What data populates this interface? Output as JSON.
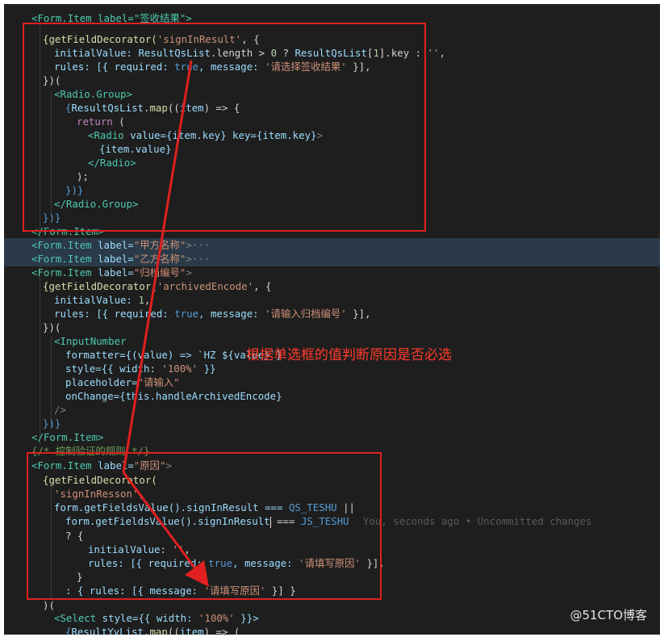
{
  "code": {
    "l1": [
      "<Form.Item label=\"签收结果\">"
    ],
    "l2": [
      "{getFieldDecorator(",
      "'signInResult'",
      ", {"
    ],
    "l3": [
      "initialValue: ",
      "ResultQsList",
      ".length > ",
      "0",
      " ? ",
      "ResultQsList",
      "[",
      "1",
      "].key : ",
      "''",
      ","
    ],
    "l4": [
      "rules: [{ required: ",
      "true",
      ", message: ",
      "'请选择签收结果'",
      " }],"
    ],
    "l5": [
      "})("
    ],
    "l6": [
      "<Radio.Group>"
    ],
    "l7": [
      "{",
      "ResultQsList",
      ".",
      "map",
      "((",
      "item",
      ") => {"
    ],
    "l8": [
      "return",
      " ("
    ],
    "l9": [
      "<Radio",
      " value=",
      "{item.key}",
      " key=",
      "{item.key}",
      ">"
    ],
    "l10": [
      "{item.value}"
    ],
    "l11": [
      "</Radio>"
    ],
    "l12": [
      ");"
    ],
    "l13": [
      "})}"
    ],
    "l14": [
      "</Radio.Group>"
    ],
    "l15": [
      "})}"
    ],
    "l16": [
      "</Form.Item>"
    ],
    "l17": [
      "<Form.Item",
      " label=",
      "\"甲方名称\"",
      ">···"
    ],
    "l18": [
      "<Form.Item",
      " label=",
      "\"乙方名称\"",
      ">···"
    ],
    "l19": [
      "<Form.Item",
      " label=",
      "\"归档编号\"",
      ">"
    ],
    "l20": [
      "{getFieldDecorator(",
      "'archivedEncode'",
      ", {"
    ],
    "l21": [
      "initialValue: ",
      "1",
      ","
    ],
    "l22": [
      "rules: [{ required: ",
      "true",
      ", message: ",
      "'请输入归档编号'",
      " }],"
    ],
    "l23": [
      "})("
    ],
    "l24": [
      "<InputNumber"
    ],
    "l25": [
      "formatter=",
      "{(value) => `HZ ${value}`}"
    ],
    "l26": [
      "style=",
      "{{ width: ",
      "'100%'",
      " }}"
    ],
    "l27": [
      "placeholder=",
      "\"请输入\""
    ],
    "l28": [
      "onChange=",
      "{this.handleArchivedEncode}"
    ],
    "l29": [
      "/>"
    ],
    "l30": [
      "})}"
    ],
    "l31": [
      "</Form.Item>"
    ],
    "l32": [
      "{/* 控制验证的规则 */}"
    ],
    "l33": [
      "<Form.Item",
      " label=",
      "\"原因\"",
      ">"
    ],
    "l34": [
      "{getFieldDecorator("
    ],
    "l35": [
      "'signInResson'",
      ","
    ],
    "l36": [
      "form.getFieldsValue().signInResult === ",
      "QS_TESHU",
      " ||"
    ],
    "l37": [
      "form.getFieldsValue().signInResult",
      " === ",
      "JS_TESHU"
    ],
    "l38": [
      "? {"
    ],
    "l39": [
      "initialValue: ",
      "''",
      ","
    ],
    "l40": [
      "rules: [{ required: ",
      "true",
      ", message: ",
      "'请填写原因'",
      " }],"
    ],
    "l41": [
      "}"
    ],
    "l42": [
      ": { rules: [{ message: ",
      "'请填写原因'",
      " }] }"
    ],
    "l43": [
      ")("
    ],
    "l44": [
      "<Select",
      " style=",
      "{{ width: ",
      "'100%'",
      " }}>"
    ],
    "l45": [
      "{",
      "ResultYyList",
      ".",
      "map",
      "((",
      "item",
      ") => ("
    ]
  },
  "blame": "You, seconds ago • Uncommitted changes",
  "annotation": "根据单选框的值判断原因是否必选",
  "watermark": "@51CTO博客",
  "colors": {
    "box": "#e02020",
    "annotation": "#ff3a2a",
    "editor_bg": "#1e1e1e"
  }
}
